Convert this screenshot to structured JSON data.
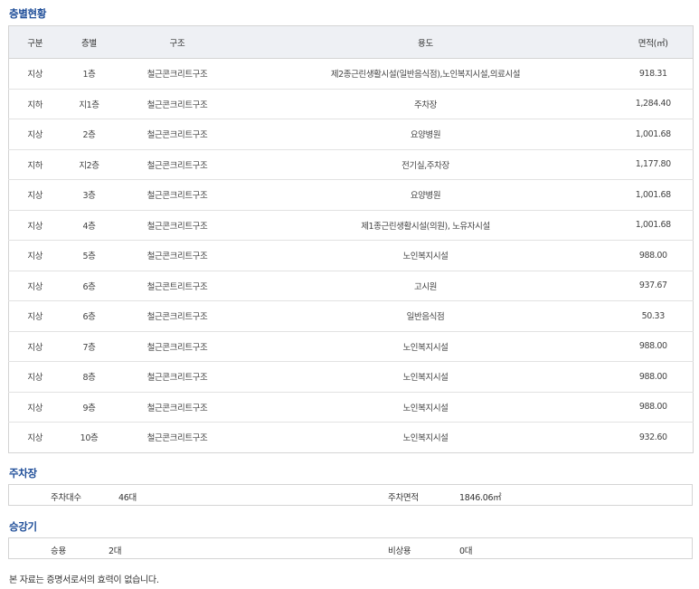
{
  "floor_section": {
    "title": "층별현황",
    "headers": {
      "division": "구분",
      "floor": "층별",
      "structure": "구조",
      "usage": "용도",
      "area": "면적(㎡)"
    },
    "rows": [
      {
        "division": "지상",
        "floor": "1층",
        "structure": "철근콘크리트구조",
        "usage": "제2종근린생활시설(일반음식점),노인복지시설,의료시설",
        "area": "918.31"
      },
      {
        "division": "지하",
        "floor": "지1층",
        "structure": "철근콘크리트구조",
        "usage": "주차장",
        "area": "1,284.40"
      },
      {
        "division": "지상",
        "floor": "2층",
        "structure": "철근콘크리트구조",
        "usage": "요양병원",
        "area": "1,001.68"
      },
      {
        "division": "지하",
        "floor": "지2층",
        "structure": "철근콘크리트구조",
        "usage": "전기실,주차장",
        "area": "1,177.80"
      },
      {
        "division": "지상",
        "floor": "3층",
        "structure": "철근콘크리트구조",
        "usage": "요양병원",
        "area": "1,001.68"
      },
      {
        "division": "지상",
        "floor": "4층",
        "structure": "철근콘크리트구조",
        "usage": "제1종근린생활시설(의원), 노유자시설",
        "area": "1,001.68"
      },
      {
        "division": "지상",
        "floor": "5층",
        "structure": "철근콘크리트구조",
        "usage": "노인복지시설",
        "area": "988.00"
      },
      {
        "division": "지상",
        "floor": "6층",
        "structure": "철근콘트리트구조",
        "usage": "고시원",
        "area": "937.67"
      },
      {
        "division": "지상",
        "floor": "6층",
        "structure": "철근콘크리트구조",
        "usage": "일반음식점",
        "area": "50.33"
      },
      {
        "division": "지상",
        "floor": "7층",
        "structure": "철근콘크리트구조",
        "usage": "노인복지시설",
        "area": "988.00"
      },
      {
        "division": "지상",
        "floor": "8층",
        "structure": "철근콘크리트구조",
        "usage": "노인복지시설",
        "area": "988.00"
      },
      {
        "division": "지상",
        "floor": "9층",
        "structure": "철근콘크리트구조",
        "usage": "노인복지시설",
        "area": "988.00"
      },
      {
        "division": "지상",
        "floor": "10층",
        "structure": "철근콘크리트구조",
        "usage": "노인복지시설",
        "area": "932.60"
      }
    ]
  },
  "parking": {
    "title": "주차장",
    "count_label": "주차대수",
    "count_value": "46대",
    "area_label": "주차면적",
    "area_value": "1846.06㎡"
  },
  "elevator": {
    "title": "승강기",
    "passenger_label": "승용",
    "passenger_value": "2대",
    "emergency_label": "비상용",
    "emergency_value": "0대"
  },
  "disclaimer": "본 자료는 증명서로서의 효력이 없습니다.",
  "colors": {
    "section_title": "#1f4e99",
    "header_bg": "#eef0f4",
    "border": "#d4d4d4"
  }
}
